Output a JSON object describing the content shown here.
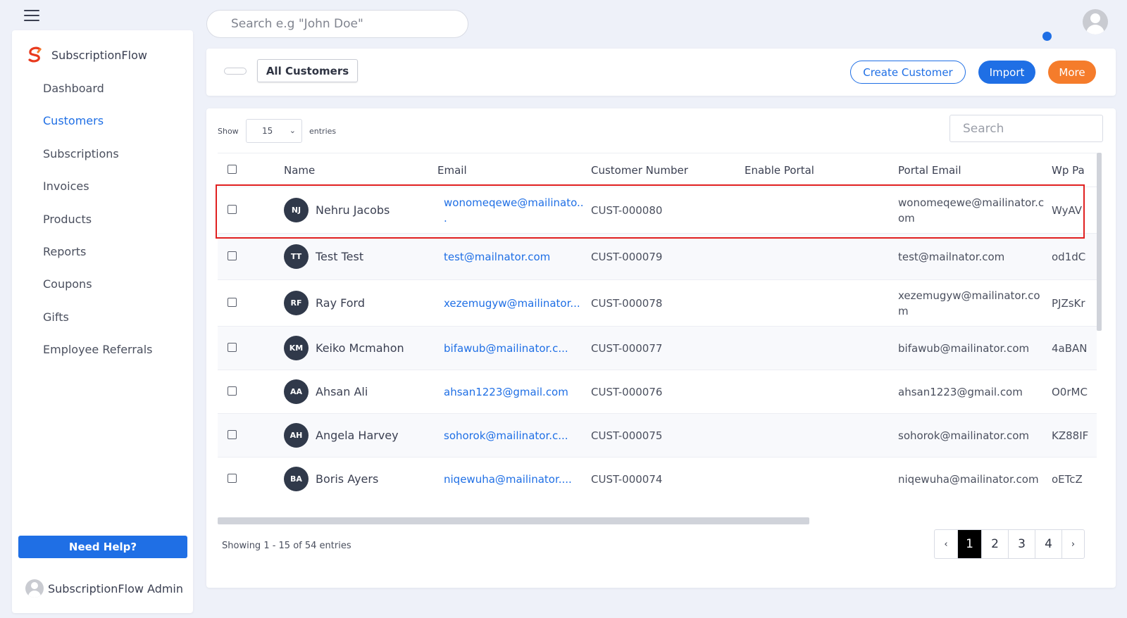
{
  "header": {
    "search_placeholder": "Search e.g \"John Doe\""
  },
  "brand": {
    "name": "SubscriptionFlow",
    "colors": {
      "accent": "#1f6fe5",
      "orange": "#f57c2b",
      "logo_red": "#e8391d"
    }
  },
  "sidebar": {
    "items": [
      {
        "label": "Dashboard"
      },
      {
        "label": "Customers"
      },
      {
        "label": "Subscriptions"
      },
      {
        "label": "Invoices"
      },
      {
        "label": "Products"
      },
      {
        "label": "Reports"
      },
      {
        "label": "Coupons"
      },
      {
        "label": "Gifts"
      },
      {
        "label": "Employee Referrals"
      }
    ],
    "active": "Customers",
    "help_label": "Need Help?",
    "admin_name": "SubscriptionFlow Admin"
  },
  "toolbar": {
    "view_label": "All Customers",
    "create_label": "Create Customer",
    "import_label": "Import",
    "more_label": "More"
  },
  "table": {
    "show_label": "Show",
    "entries_value": "15",
    "entries_label": "entries",
    "search_placeholder": "Search",
    "columns": [
      "Name",
      "Email",
      "Customer Number",
      "Enable Portal",
      "Portal Email",
      "Wp Pa"
    ],
    "rows": [
      {
        "initials": "NJ",
        "name": "Nehru Jacobs",
        "email": "wonomeqewe@mailinato..",
        "email_cont": ".",
        "number": "CUST-000080",
        "portal": "",
        "portal_email": "wonomeqewe@mailinator.c",
        "portal_email_cont": "om",
        "wp": "WyAV"
      },
      {
        "initials": "TT",
        "name": "Test Test",
        "email": "test@mailnator.com",
        "number": "CUST-000079",
        "portal": "",
        "portal_email": "test@mailnator.com",
        "wp": "od1dC"
      },
      {
        "initials": "RF",
        "name": "Ray Ford",
        "email": "xezemugyw@mailinator...",
        "number": "CUST-000078",
        "portal": "",
        "portal_email": "xezemugyw@mailinator.co",
        "portal_email_cont": "m",
        "wp": "PJZsKr"
      },
      {
        "initials": "KM",
        "name": "Keiko Mcmahon",
        "email": "bifawub@mailinator.c...",
        "number": "CUST-000077",
        "portal": "",
        "portal_email": "bifawub@mailinator.com",
        "wp": "4aBAN"
      },
      {
        "initials": "AA",
        "name": "Ahsan Ali",
        "email": "ahsan1223@gmail.com",
        "number": "CUST-000076",
        "portal": "",
        "portal_email": "ahsan1223@gmail.com",
        "wp": "O0rMC"
      },
      {
        "initials": "AH",
        "name": "Angela Harvey",
        "email": "sohorok@mailinator.c...",
        "number": "CUST-000075",
        "portal": "",
        "portal_email": "sohorok@mailinator.com",
        "wp": "KZ88IF"
      },
      {
        "initials": "BA",
        "name": "Boris Ayers",
        "email": "niqewuha@mailinator....",
        "number": "CUST-000074",
        "portal": "",
        "portal_email": "niqewuha@mailinator.com",
        "wp": "oETcZ"
      }
    ],
    "footer_text": "Showing 1 - 15 of 54 entries",
    "pagination": {
      "prev": "‹",
      "pages": [
        "1",
        "2",
        "3",
        "4"
      ],
      "current": "1",
      "next": "›"
    }
  }
}
